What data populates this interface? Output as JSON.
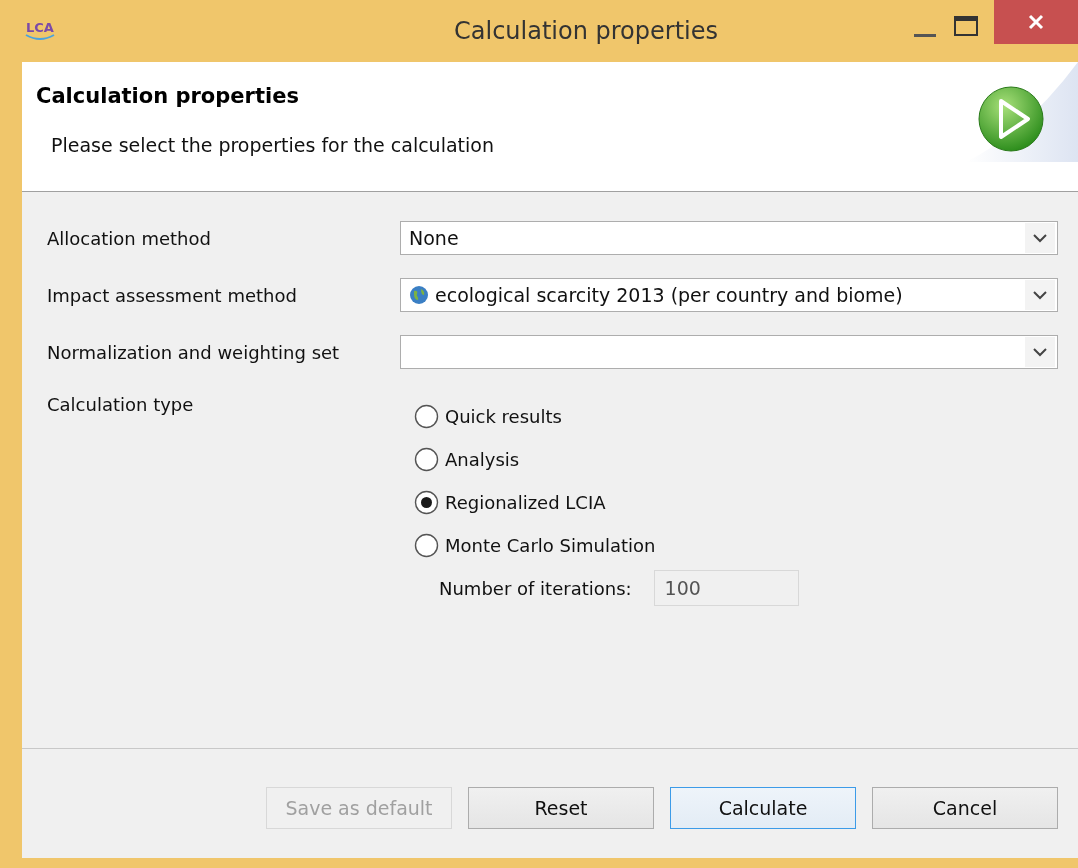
{
  "window": {
    "title": "Calculation properties",
    "logo_text": "LCA"
  },
  "header": {
    "title": "Calculation properties",
    "description": "Please select the properties for the calculation"
  },
  "fields": [
    {
      "label": "Allocation method",
      "value": "None",
      "has_icon": false
    },
    {
      "label": "Impact assessment method",
      "value": "ecological scarcity 2013 (per country and biome)",
      "has_icon": true
    },
    {
      "label": "Normalization and weighting set",
      "has_icon": false
    }
  ],
  "calculation_type": {
    "label": "Calculation type",
    "options": [
      {
        "label": "Quick results",
        "selected": false
      },
      {
        "label": "Analysis",
        "selected": false
      },
      {
        "label": "Regionalized LCIA",
        "selected": true
      },
      {
        "label": "Monte Carlo Simulation",
        "selected": false
      }
    ]
  },
  "iterations": {
    "label": "Number of iterations:",
    "value": "100",
    "disabled": true
  },
  "buttons": [
    {
      "label": "Save as default",
      "disabled": true,
      "focused": false
    },
    {
      "label": "Reset",
      "disabled": false,
      "focused": false
    },
    {
      "label": "Calculate",
      "disabled": false,
      "focused": true
    },
    {
      "label": "Cancel",
      "disabled": false,
      "focused": false
    }
  ]
}
